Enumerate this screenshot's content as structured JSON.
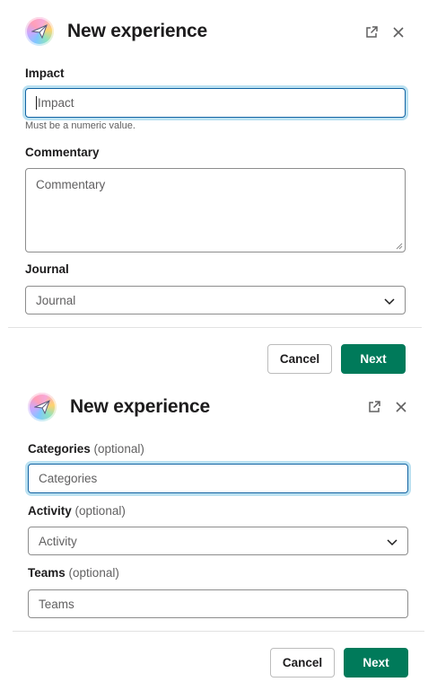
{
  "modal1": {
    "title": "New experience",
    "fields": {
      "impact": {
        "label": "Impact",
        "placeholder": "Impact",
        "hint": "Must be a numeric value."
      },
      "commentary": {
        "label": "Commentary",
        "placeholder": "Commentary"
      },
      "journal": {
        "label": "Journal",
        "value": "Journal"
      }
    },
    "buttons": {
      "cancel": "Cancel",
      "next": "Next"
    }
  },
  "modal2": {
    "title": "New experience",
    "fields": {
      "categories": {
        "label": "Categories",
        "optional": "(optional)",
        "placeholder": "Categories"
      },
      "activity": {
        "label": "Activity",
        "optional": "(optional)",
        "value": "Activity"
      },
      "teams": {
        "label": "Teams",
        "optional": "(optional)",
        "placeholder": "Teams"
      }
    },
    "buttons": {
      "cancel": "Cancel",
      "next": "Next"
    }
  },
  "icons": [
    "app-avatar-icon",
    "external-link-icon",
    "close-icon",
    "chevron-down-icon",
    "resize-handle-icon"
  ],
  "colors": {
    "primary": "#007a5a",
    "focus": "#1264a3",
    "text": "#1d1c1d",
    "muted": "#616061"
  }
}
